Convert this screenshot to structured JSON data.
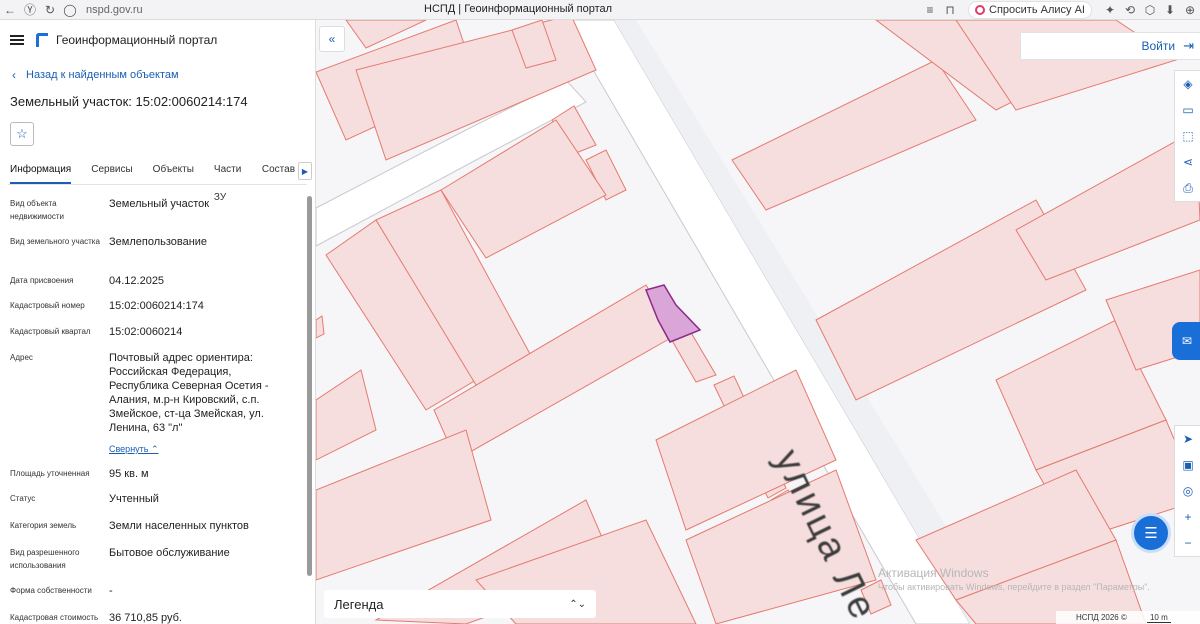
{
  "browser": {
    "url": "nspd.gov.ru",
    "tab_title": "НСПД | Геоинформационный портал",
    "alice_label": "Спросить Алису AI",
    "icons": [
      "back-icon",
      "ya-icon",
      "reload-icon",
      "shield-icon",
      "bookmark-icon"
    ]
  },
  "header": {
    "title": "Геоинформационный портал"
  },
  "back_link": "Назад к найденным объектам",
  "object_title": "Земельный участок: 15:02:0060214:174",
  "tabs": [
    "Информация",
    "Сервисы",
    "Объекты",
    "Части ЗУ",
    "Состав"
  ],
  "properties": [
    {
      "key": "Вид объекта недвижимости",
      "value": "Земельный участок"
    },
    {
      "key": "Вид земельного участка",
      "value": "Землепользование"
    },
    {
      "key": "Дата присвоения",
      "value": "04.12.2025"
    },
    {
      "key": "Кадастровый номер",
      "value": "15:02:0060214:174"
    },
    {
      "key": "Кадастровый квартал",
      "value": "15:02:0060214"
    },
    {
      "key": "Адрес",
      "value": "Почтовый адрес ориентира: Российская Федерация, Республика Северная Осетия - Алания, м.р-н Кировский, с.п. Змейское, ст-ца Змейская, ул. Ленина, 63 \"л\""
    },
    {
      "key": "Площадь уточненная",
      "value": "95 кв. м"
    },
    {
      "key": "Статус",
      "value": "Учтенный"
    },
    {
      "key": "Категория земель",
      "value": "Земли населенных пунктов"
    },
    {
      "key": "Вид разрешенного использования",
      "value": "Бытовое обслуживание"
    },
    {
      "key": "Форма собственности",
      "value": "-"
    },
    {
      "key": "Кадастровая стоимость",
      "value": "36 710,85 руб."
    }
  ],
  "collapse_label": "Свернуть",
  "map": {
    "login_label": "Войти",
    "legend_label": "Легенда",
    "street_label": "улица Ле",
    "watermark_title": "Активация Windows",
    "watermark_text": "Чтобы активировать Windows, перейдите в раздел \"Параметры\".",
    "copyright": "НСПД 2026 ©",
    "scale": "10 m",
    "colors": {
      "parcel_fill": "#f6dede",
      "parcel_stroke": "#e57a6e",
      "selected_fill": "#d9a6d7",
      "selected_stroke": "#8d2a8a",
      "road": "#ffffff",
      "accent": "#1a6ed8"
    }
  }
}
